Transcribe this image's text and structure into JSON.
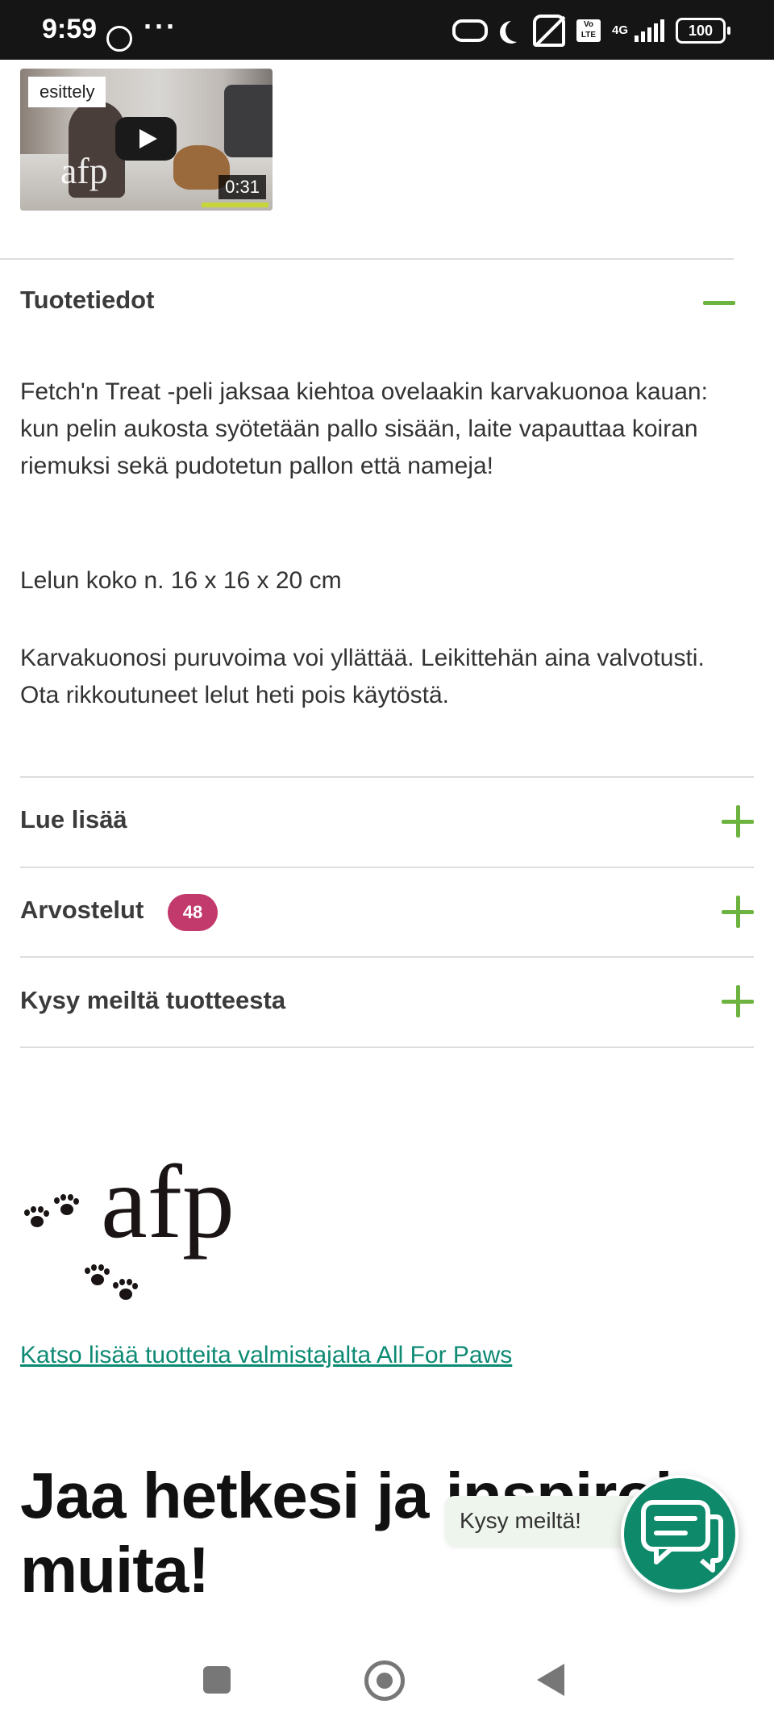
{
  "status_bar": {
    "time": "9:59",
    "volte_label": "Vo LTE",
    "network": "4G",
    "battery": "100",
    "icons": [
      "whatsapp-icon",
      "more-dots-icon",
      "link-icon",
      "moon-icon",
      "mute-icon",
      "volte-icon",
      "signal-icon",
      "battery-icon"
    ]
  },
  "video": {
    "tag": "esittely",
    "duration": "0:31"
  },
  "sections": {
    "product_info": {
      "title": "Tuotetiedot",
      "paragraph1": "Fetch'n Treat -peli jaksaa kiehtoa ovelaakin karvakuonoa kauan: kun pelin aukosta syötetään pallo sisään, laite vapauttaa koiran riemuksi sekä pudotetun pallon että nameja!",
      "paragraph2": "Lelun koko n. 16 x 16 x 20 cm",
      "paragraph3": "Karvakuonosi puruvoima voi yllättää. Leikittehän aina valvotusti. Ota rikkoutuneet lelut heti pois käytöstä."
    },
    "read_more": {
      "title": "Lue lisää"
    },
    "reviews": {
      "title": "Arvostelut",
      "count": "48"
    },
    "ask_us": {
      "title": "Kysy meiltä tuotteesta"
    }
  },
  "brand": {
    "logo_text": "afp",
    "link": "Katso lisää tuotteita valmistajalta All For Paws"
  },
  "headline": "Jaa hetkesi ja inspiroi muita!",
  "chat": {
    "bubble": "Kysy meiltä!"
  },
  "colors": {
    "accent_green": "#6db33f",
    "link_teal": "#0d8a73",
    "badge_pink": "#c23a6b",
    "chat_green": "#0e8a6b"
  }
}
